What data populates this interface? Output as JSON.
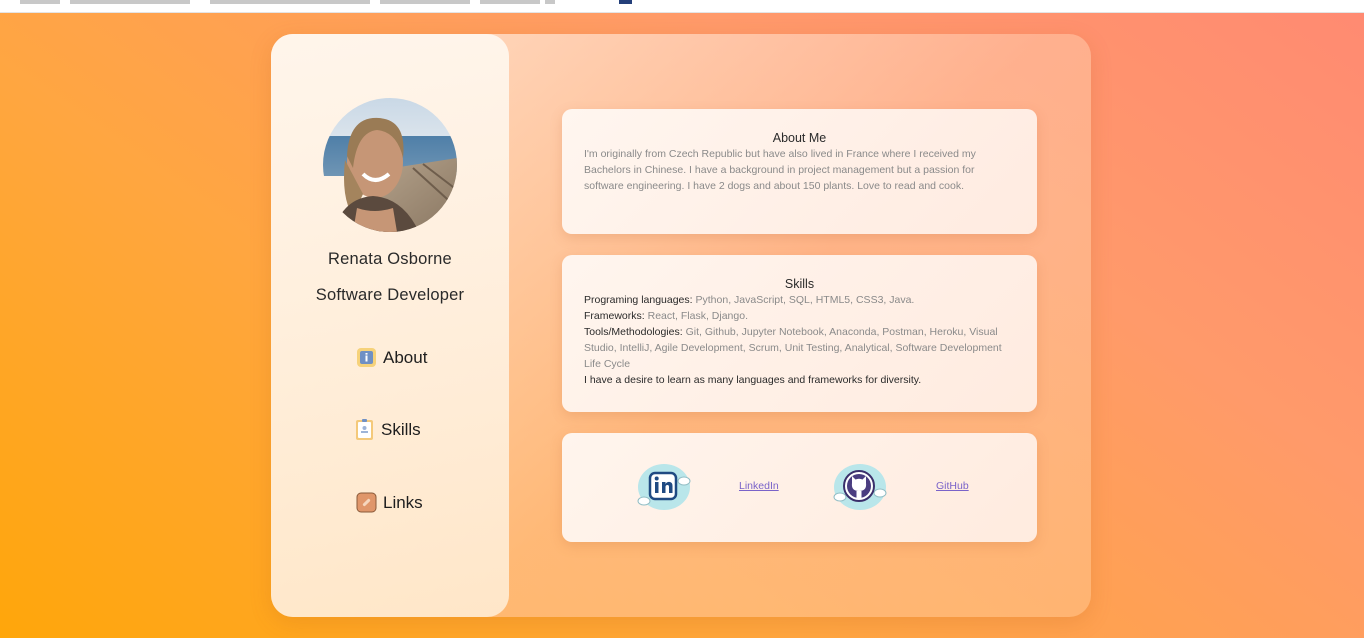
{
  "profile": {
    "name": "Renata Osborne",
    "role": "Software Developer"
  },
  "nav": [
    {
      "label": "About",
      "icon": "info-icon"
    },
    {
      "label": "Skills",
      "icon": "clipboard-icon"
    },
    {
      "label": "Links",
      "icon": "link-icon"
    }
  ],
  "about": {
    "title": "About Me",
    "text": "I'm originally from Czech Republic but have also lived in France where I received my Bachelors in Chinese. I have a background in project management but a passion for software engineering. I have 2 dogs and about 150 plants. Love to read and cook."
  },
  "skills": {
    "title": "Skills",
    "languages_label": "Programing languages:",
    "languages": "Python, JavaScript, SQL, HTML5, CSS3, Java.",
    "frameworks_label": "Frameworks:",
    "frameworks": "React, Flask, Django.",
    "tools_label": "Tools/Methodologies:",
    "tools": "Git, Github, Jupyter Notebook, Anaconda, Postman, Heroku, Visual Studio, IntelliJ, Agile Development, Scrum, Unit Testing, Analytical, Software Development Life Cycle",
    "closing": "I have a desire to learn as many languages and frameworks for diversity."
  },
  "links": {
    "linkedin_label": "LinkedIn",
    "github_label": "GitHub"
  },
  "colors": {
    "background_start": "#ffa60a",
    "background_end": "#ff8a72",
    "link": "#7a63c9"
  }
}
